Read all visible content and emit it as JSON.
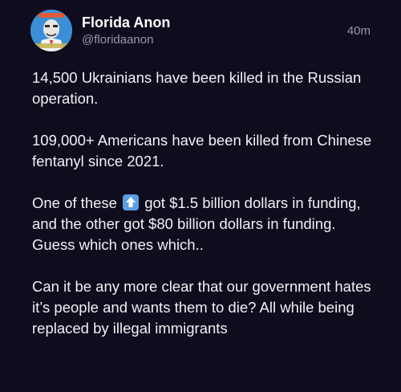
{
  "post": {
    "author_name": "Florida Anon",
    "author_handle": "@floridaanon",
    "timestamp": "40m",
    "avatar_icon": "cartoon-man-avatar-icon",
    "paragraphs": {
      "p1": "14,500 Ukrainians have been killed in the Russian operation.",
      "p2": "109,000+ Americans have been killed from Chinese fentanyl since 2021.",
      "p3_before": "One of these ",
      "p3_emoji_icon": "up-arrow-emoji-icon",
      "p3_after": " got $1.5 billion dollars in funding, and the other got $80 billion dollars in funding. Guess which ones which..",
      "p4": "Can it be any more clear that our government hates it’s people and wants them to die? All while being replaced by illegal immigrants"
    }
  },
  "colors": {
    "background": "#0e0c1d",
    "text": "#f1f1f4",
    "muted": "#9a98a8",
    "emoji_blue": "#5b9fe3"
  }
}
